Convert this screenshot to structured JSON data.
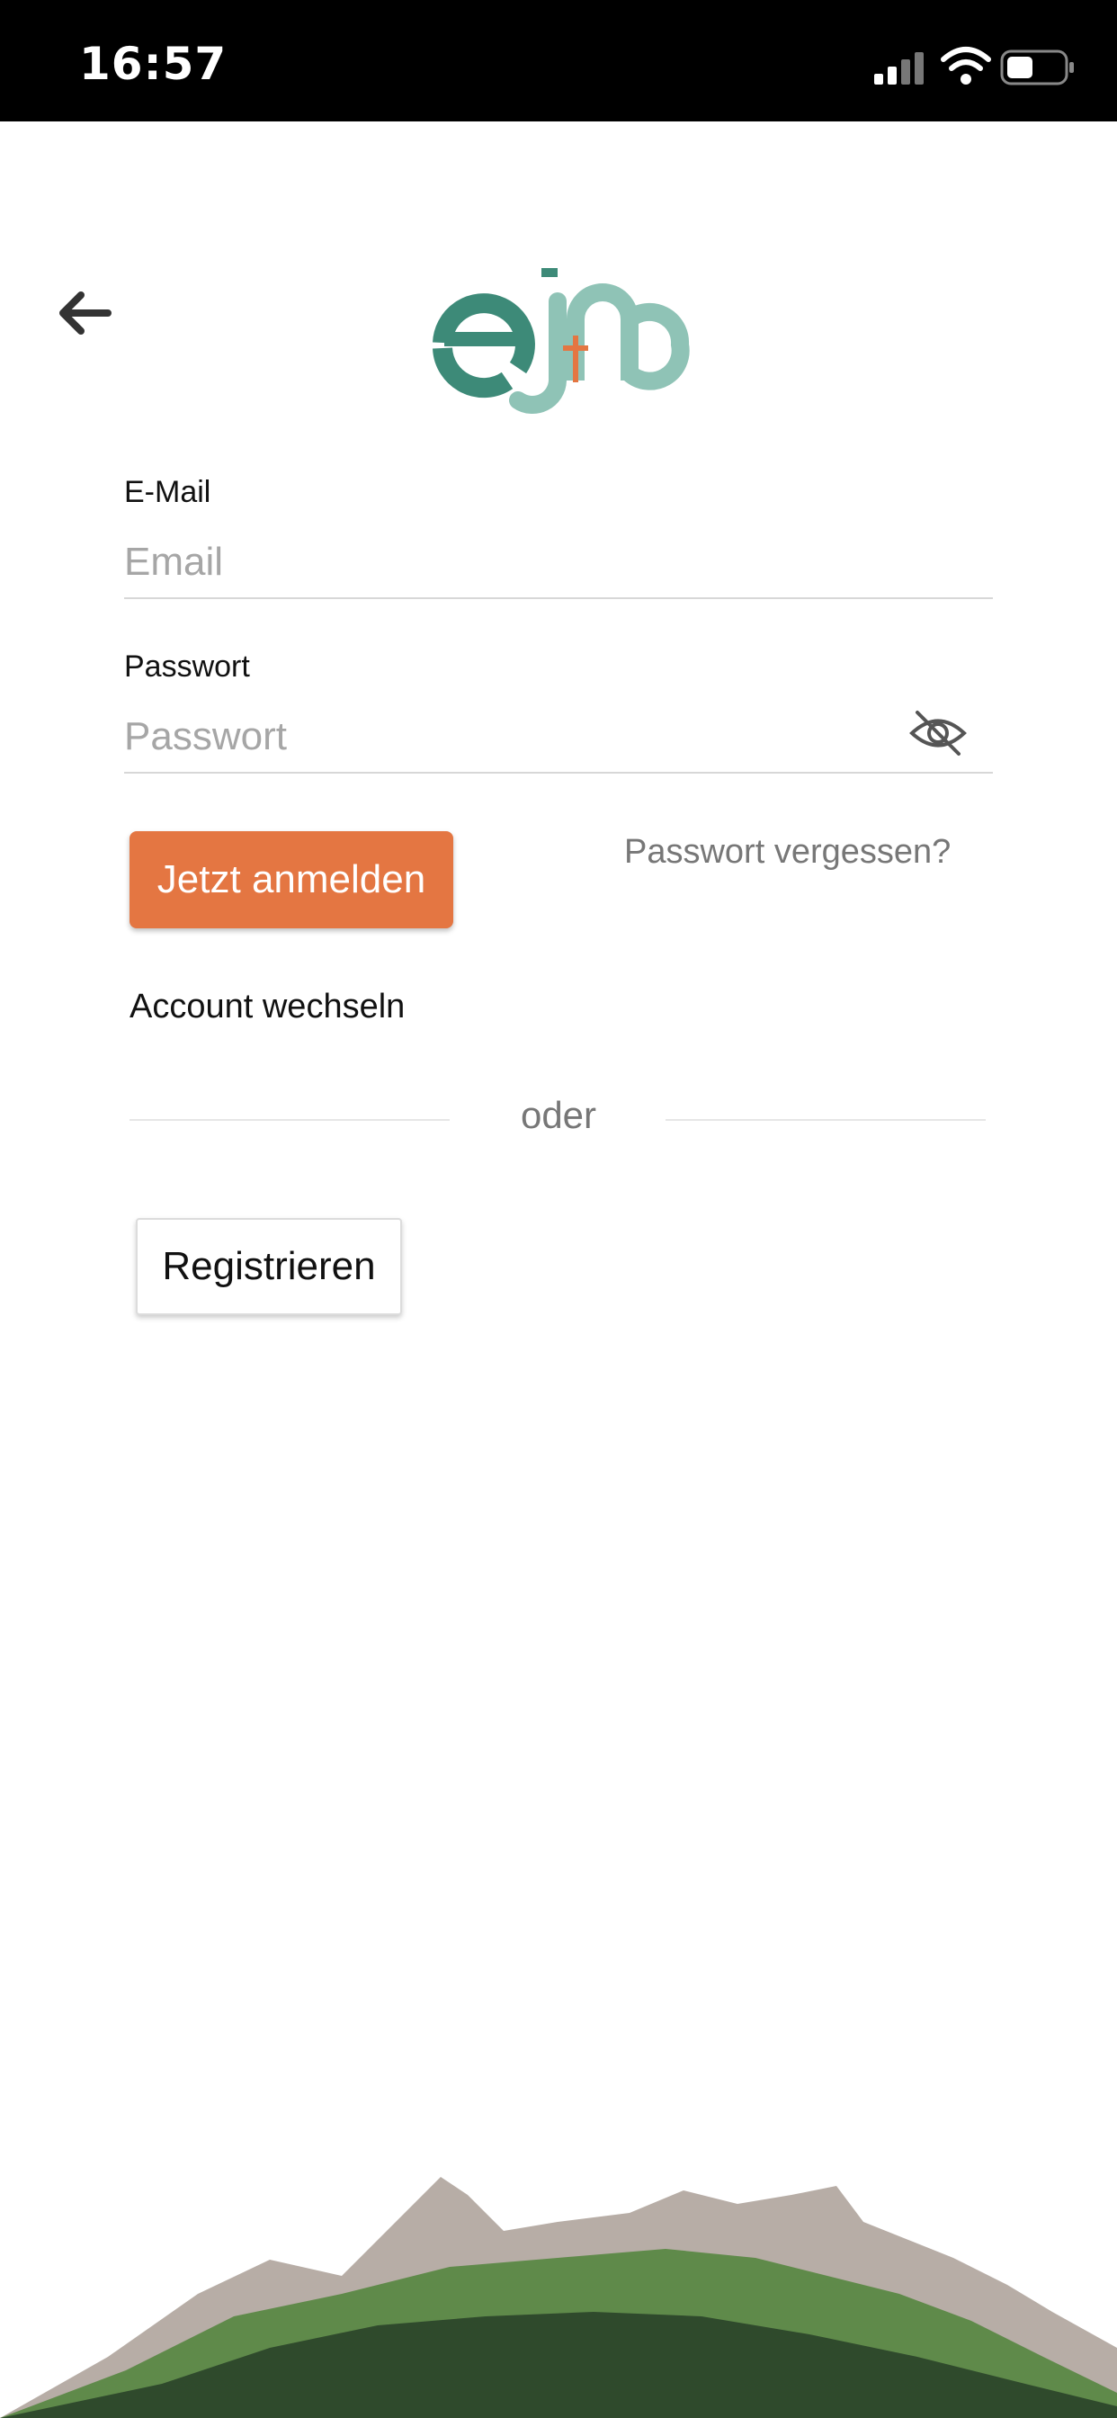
{
  "status_bar": {
    "time": "16:57",
    "icons": [
      "signal-icon",
      "wifi-icon",
      "battery-icon"
    ]
  },
  "header": {
    "back_icon": "arrow-left-icon",
    "logo_text": "egmo"
  },
  "form": {
    "email": {
      "label": "E-Mail",
      "placeholder": "Email",
      "value": ""
    },
    "password": {
      "label": "Passwort",
      "placeholder": "Passwort",
      "value": "",
      "toggle_icon": "eye-slash-icon"
    },
    "login_label": "Jetzt anmelden",
    "forgot_label": "Passwort vergessen?",
    "switch_account_label": "Account wechseln",
    "divider_text": "oder",
    "register_label": "Registrieren"
  },
  "colors": {
    "accent": "#e47642",
    "logo_dark": "#3d8a78",
    "logo_light": "#8fc3b6",
    "status_bar": "#000000"
  },
  "footer": {
    "image": "mountain-landscape"
  }
}
